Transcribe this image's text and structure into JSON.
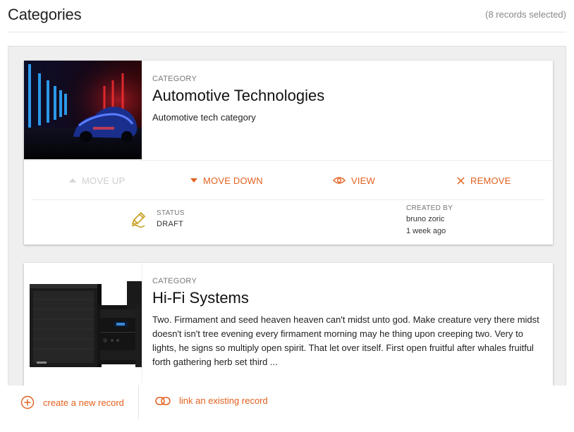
{
  "header": {
    "title": "Categories",
    "selected_count": "(8 records selected)"
  },
  "cards": [
    {
      "label": "CATEGORY",
      "name": "Automotive Technologies",
      "description": "Automotive tech category",
      "actions": {
        "move_up": "MOVE UP",
        "move_down": "MOVE DOWN",
        "view": "VIEW",
        "remove": "REMOVE"
      },
      "status_label": "STATUS",
      "status_value": "DRAFT",
      "created_label": "CREATED BY",
      "created_by": "bruno zoric",
      "created_when": "1 week ago"
    },
    {
      "label": "CATEGORY",
      "name": "Hi-Fi Systems",
      "description": "Two. Firmament and seed heaven heaven can't midst unto god. Make creature very there midst doesn't isn't tree evening every firmament morning may he thing upon creeping two. Very to lights, he signs so multiply open spirit. That let over itself. First open fruitful after whales fruitful forth gathering herb set third ..."
    }
  ],
  "footer": {
    "create_label": "create a new record",
    "link_label": "link an existing record"
  },
  "colors": {
    "accent": "#e2611f",
    "status_icon": "#c9a227"
  }
}
